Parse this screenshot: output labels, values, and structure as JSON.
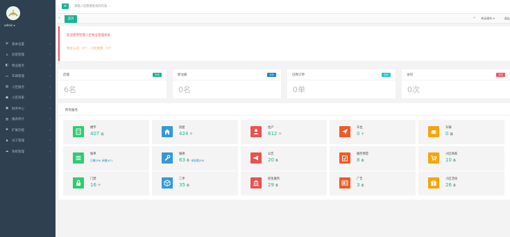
{
  "sidebar": {
    "admin_label": "admin ▾",
    "items": [
      {
        "label": "基本设置",
        "icon": "gear-icon"
      },
      {
        "label": "房屋管理",
        "icon": "home-icon"
      },
      {
        "label": "物业服务",
        "icon": "service-icon"
      },
      {
        "label": "车辆管理",
        "icon": "car-icon"
      },
      {
        "label": "小区服务",
        "icon": "store-icon"
      },
      {
        "label": "小区商家",
        "icon": "shop-icon"
      },
      {
        "label": "财务中心",
        "icon": "wallet-icon"
      },
      {
        "label": "报表统计",
        "icon": "chart-icon"
      },
      {
        "label": "扩展功能",
        "icon": "puzzle-icon"
      },
      {
        "label": "员工管理",
        "icon": "users-icon"
      },
      {
        "label": "系统管理",
        "icon": "cloud-icon"
      }
    ]
  },
  "topbar": {
    "toggle_label": "≡",
    "search_placeholder": "请输入您需要查找的内容 …"
  },
  "tabs": {
    "active": "首页",
    "close_ops": "关闭操作 ▾",
    "exit": "退出"
  },
  "welcome": {
    "title": "欢迎使用智慧小区物业管理系统",
    "subtitle": "物业公司：0个，小区数量：0个"
  },
  "stats": [
    {
      "title": "店铺",
      "badge": "今天",
      "value": "6名",
      "badge_color": "#1ab394"
    },
    {
      "title": "新注册",
      "badge": "今天",
      "value": "0名",
      "badge_color": "#1c84c6"
    },
    {
      "title": "已购订单",
      "badge": "今天",
      "value": "0单",
      "badge_color": "#23c6c8"
    },
    {
      "title": "访问",
      "badge": "今天",
      "value": "0次",
      "badge_color": "#ed5565"
    }
  ],
  "services": {
    "title": "所有服务",
    "tiles": [
      {
        "name": "楼宇",
        "num": "407",
        "unit": "栋",
        "extra": "",
        "icon": "building-icon",
        "color": "#2ecc71"
      },
      {
        "name": "房屋",
        "num": "424",
        "unit": "个",
        "extra": "",
        "icon": "house-icon",
        "color": "#3498db"
      },
      {
        "name": "住户",
        "num": "612",
        "unit": "个",
        "extra": "",
        "icon": "resident-icon",
        "color": "#e8534f"
      },
      {
        "name": "车位",
        "num": "0",
        "unit": "个",
        "extra": "",
        "icon": "send-icon",
        "color": "#f05a24"
      },
      {
        "name": "车辆",
        "num": "0",
        "unit": "辆",
        "extra": "",
        "icon": "car-icon",
        "color": "#f4a50c"
      },
      {
        "name": "账单",
        "num": "",
        "unit": "",
        "extra": "已缴(26) 未缴(67)",
        "icon": "list-icon",
        "color": "#2ecc71"
      },
      {
        "name": "报修",
        "num": "63",
        "unit": "条",
        "extra": "未处理(59)",
        "icon": "wrench-icon",
        "color": "#3498db"
      },
      {
        "name": "公告",
        "num": "20",
        "unit": "条",
        "extra": "",
        "icon": "megaphone-icon",
        "color": "#e8534f"
      },
      {
        "name": "服务预定",
        "num": "8",
        "unit": "条",
        "extra": "",
        "icon": "calendar-check-icon",
        "color": "#f05a24"
      },
      {
        "name": "小区商家",
        "num": "10",
        "unit": "条",
        "extra": "",
        "icon": "cart-icon",
        "color": "#f4a50c"
      },
      {
        "name": "门禁",
        "num": "16",
        "unit": "个",
        "extra": "",
        "icon": "lock-icon",
        "color": "#2ecc71"
      },
      {
        "name": "二手",
        "num": "35",
        "unit": "条",
        "extra": "",
        "icon": "box-icon",
        "color": "#3498db"
      },
      {
        "name": "民生服务",
        "num": "29",
        "unit": "条",
        "extra": "",
        "icon": "institution-icon",
        "color": "#e8534f"
      },
      {
        "name": "广告",
        "num": "3",
        "unit": "条",
        "extra": "",
        "icon": "ad-icon",
        "color": "#f05a24"
      },
      {
        "name": "小区活动",
        "num": "26",
        "unit": "条",
        "extra": "",
        "icon": "gift-icon",
        "color": "#f4a50c"
      }
    ]
  }
}
